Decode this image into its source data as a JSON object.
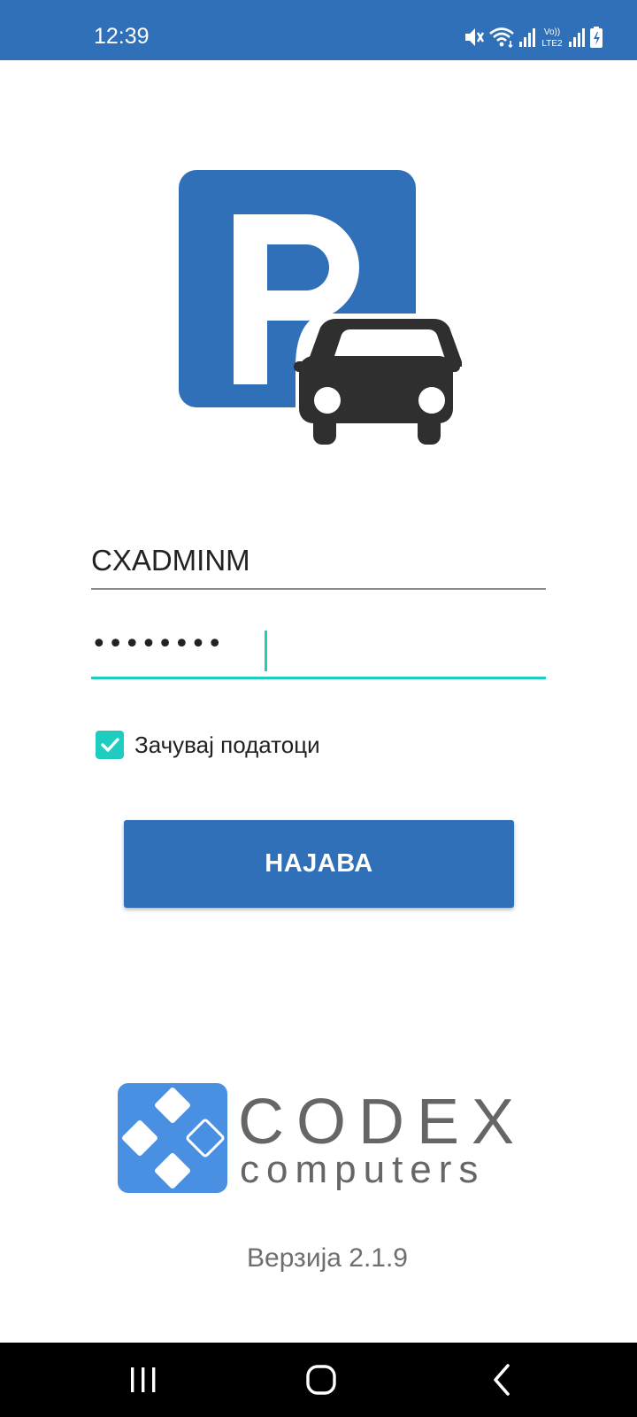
{
  "status_bar": {
    "time": "12:39",
    "icons": [
      "mute-icon",
      "wifi-icon",
      "signal-icon",
      "volte-icon",
      "signal-icon",
      "battery-charging-icon"
    ],
    "volte_label_top": "Vo))",
    "volte_label_bottom": "LTE2"
  },
  "login": {
    "username_value": "CXADMINM",
    "password_value": "••••••••",
    "remember_checked": true,
    "remember_label": "Зачувај податоци",
    "submit_label": "НАЈАВА"
  },
  "branding": {
    "company_name": "CODEX",
    "company_subtitle": "computers",
    "version_label": "Верзија 2.1.9"
  },
  "navigation": {
    "buttons": [
      "recent-apps-icon",
      "home-icon",
      "back-icon"
    ]
  },
  "colors": {
    "primary": "#3070b8",
    "accent": "#1fcdc0",
    "codex_blue": "#4a90e2",
    "codex_gray": "#666666"
  }
}
